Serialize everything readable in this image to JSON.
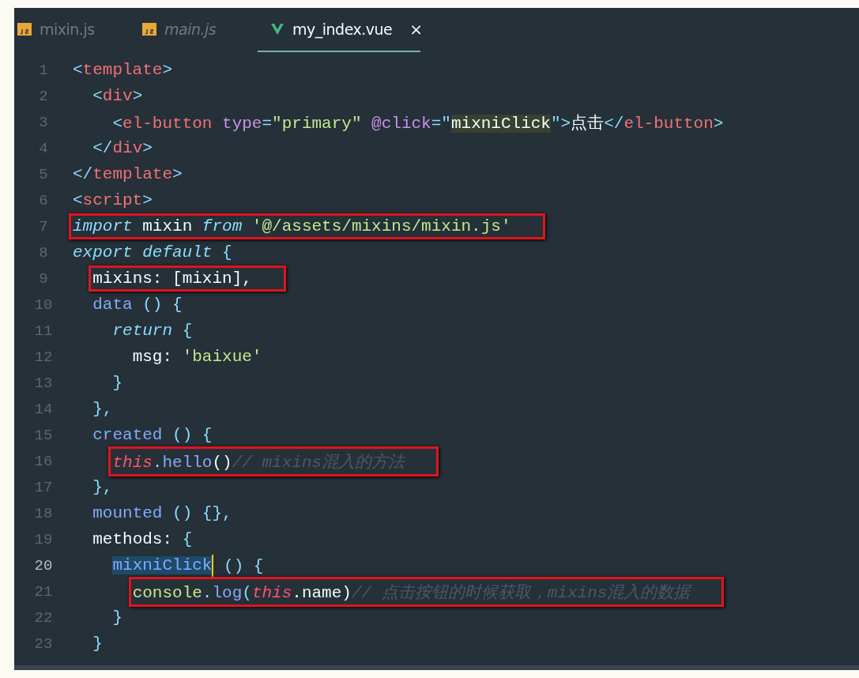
{
  "tabs": [
    {
      "label": "mixin.js",
      "kind": "js",
      "selected": false,
      "preview": false
    },
    {
      "label": "main.js",
      "kind": "js",
      "selected": false,
      "preview": true
    },
    {
      "label": "my_index.vue",
      "kind": "vue",
      "selected": true,
      "preview": false,
      "close": "×"
    }
  ],
  "lines": [
    {
      "number": "1",
      "current": false,
      "boxed": false,
      "tokens": [
        {
          "text": "<",
          "kind": "punct"
        },
        {
          "text": "template",
          "kind": "tag"
        },
        {
          "text": ">",
          "kind": "punct"
        }
      ]
    },
    {
      "number": "2",
      "current": false,
      "boxed": false,
      "tokens": [
        {
          "text": "  <",
          "kind": "punct"
        },
        {
          "text": "div",
          "kind": "tag"
        },
        {
          "text": ">",
          "kind": "punct"
        }
      ]
    },
    {
      "number": "3",
      "current": false,
      "boxed": false,
      "tokens": [
        {
          "text": "    <",
          "kind": "punct"
        },
        {
          "text": "el-button",
          "kind": "tag"
        },
        {
          "text": " type",
          "kind": "attr"
        },
        {
          "text": "=",
          "kind": "punct"
        },
        {
          "text": "\"primary\"",
          "kind": "string"
        },
        {
          "text": " @click",
          "kind": "attr"
        },
        {
          "text": "=\"",
          "kind": "punct"
        },
        {
          "text": "mixniClick",
          "kind": "match"
        },
        {
          "text": "\">",
          "kind": "punct"
        },
        {
          "text": "点击",
          "kind": "plain"
        },
        {
          "text": "</",
          "kind": "punct"
        },
        {
          "text": "el-button",
          "kind": "tag"
        },
        {
          "text": ">",
          "kind": "punct"
        }
      ]
    },
    {
      "number": "4",
      "current": false,
      "boxed": false,
      "tokens": [
        {
          "text": "  </",
          "kind": "punct"
        },
        {
          "text": "div",
          "kind": "tag"
        },
        {
          "text": ">",
          "kind": "punct"
        }
      ]
    },
    {
      "number": "5",
      "current": false,
      "boxed": false,
      "tokens": [
        {
          "text": "</",
          "kind": "punct"
        },
        {
          "text": "template",
          "kind": "tag"
        },
        {
          "text": ">",
          "kind": "punct"
        }
      ]
    },
    {
      "number": "6",
      "current": false,
      "boxed": false,
      "tokens": [
        {
          "text": "<",
          "kind": "punct"
        },
        {
          "text": "script",
          "kind": "tag"
        },
        {
          "text": ">",
          "kind": "punct"
        }
      ]
    },
    {
      "number": "7",
      "current": false,
      "boxed": true,
      "tokens": [
        {
          "text": "import",
          "kind": "keyword"
        },
        {
          "text": " mixin ",
          "kind": "plain"
        },
        {
          "text": "from",
          "kind": "keyword"
        },
        {
          "text": " '@/assets/mixins/mixin.js'",
          "kind": "string"
        }
      ]
    },
    {
      "number": "8",
      "current": false,
      "boxed": false,
      "tokens": [
        {
          "text": "export default",
          "kind": "keyword"
        },
        {
          "text": " {",
          "kind": "punct"
        }
      ]
    },
    {
      "number": "9",
      "current": false,
      "boxed": true,
      "tokens": [
        {
          "text": "  mixins: [mixin],",
          "kind": "plain"
        }
      ]
    },
    {
      "number": "10",
      "current": false,
      "boxed": false,
      "tokens": [
        {
          "text": "  data",
          "kind": "func"
        },
        {
          "text": " () {",
          "kind": "punct"
        }
      ]
    },
    {
      "number": "11",
      "current": false,
      "boxed": false,
      "tokens": [
        {
          "text": "    return",
          "kind": "keyword"
        },
        {
          "text": " {",
          "kind": "punct"
        }
      ]
    },
    {
      "number": "12",
      "current": false,
      "boxed": false,
      "tokens": [
        {
          "text": "      msg: ",
          "kind": "plain"
        },
        {
          "text": "'baixue'",
          "kind": "string"
        }
      ]
    },
    {
      "number": "13",
      "current": false,
      "boxed": false,
      "tokens": [
        {
          "text": "    }",
          "kind": "punct"
        }
      ]
    },
    {
      "number": "14",
      "current": false,
      "boxed": false,
      "tokens": [
        {
          "text": "  },",
          "kind": "punct"
        }
      ]
    },
    {
      "number": "15",
      "current": false,
      "boxed": false,
      "tokens": [
        {
          "text": "  created",
          "kind": "func"
        },
        {
          "text": " () {",
          "kind": "punct"
        }
      ]
    },
    {
      "number": "16",
      "current": false,
      "boxed": true,
      "tokens": [
        {
          "text": "    this",
          "kind": "this"
        },
        {
          "text": ".",
          "kind": "punct"
        },
        {
          "text": "hello",
          "kind": "func"
        },
        {
          "text": "()",
          "kind": "plain"
        },
        {
          "text": "// mixins混入的方法",
          "kind": "comment"
        }
      ]
    },
    {
      "number": "17",
      "current": false,
      "boxed": false,
      "tokens": [
        {
          "text": "  },",
          "kind": "punct"
        }
      ]
    },
    {
      "number": "18",
      "current": false,
      "boxed": false,
      "tokens": [
        {
          "text": "  mounted",
          "kind": "func"
        },
        {
          "text": " () {},",
          "kind": "punct"
        }
      ]
    },
    {
      "number": "19",
      "current": false,
      "boxed": false,
      "tokens": [
        {
          "text": "  methods: ",
          "kind": "plain"
        },
        {
          "text": "{",
          "kind": "punct"
        }
      ]
    },
    {
      "number": "20",
      "current": true,
      "boxed": false,
      "tokens": [
        {
          "text": "    mixniClick",
          "kind": "selection"
        },
        {
          "text": " () {",
          "kind": "punct"
        }
      ]
    },
    {
      "number": "21",
      "current": false,
      "boxed": true,
      "tokens": [
        {
          "text": "      console",
          "kind": "string"
        },
        {
          "text": ".",
          "kind": "punct"
        },
        {
          "text": "log",
          "kind": "func"
        },
        {
          "text": "(",
          "kind": "punct"
        },
        {
          "text": "this",
          "kind": "this"
        },
        {
          "text": ".name)",
          "kind": "plain"
        },
        {
          "text": "// 点击按钮的时候获取，mixins混入的数据",
          "kind": "comment"
        }
      ]
    },
    {
      "number": "22",
      "current": false,
      "boxed": false,
      "tokens": [
        {
          "text": "    }",
          "kind": "punct"
        }
      ]
    },
    {
      "number": "23",
      "current": false,
      "boxed": false,
      "tokens": [
        {
          "text": "  }",
          "kind": "punct"
        }
      ]
    }
  ]
}
